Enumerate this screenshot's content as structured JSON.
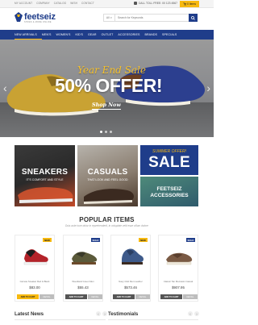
{
  "topbar": {
    "links": [
      "MY ACCOUNT",
      "COMPANY",
      "CATALOG",
      "WISH",
      "CONTACT"
    ],
    "phone": "CALL TOLL FREE: 00 123 4567",
    "cart_label": "0 Items"
  },
  "header": {
    "logo_text": "feetseiz",
    "logo_tagline": "SHOES & MORE ONLINE",
    "search_category": "All",
    "search_placeholder": "Search for Keywords"
  },
  "nav": {
    "items": [
      "NEW ARRIVALS",
      "MEN'S",
      "WOMEN'S",
      "KID'S",
      "GEAR",
      "OUTLET",
      "ACCESSORIES",
      "BRANDS",
      "SPECIALS"
    ]
  },
  "hero": {
    "subtitle": "Year End Sale",
    "title": "50% OFFER!",
    "cta": "Shop Now"
  },
  "banners": {
    "sneakers": {
      "title": "SNEAKERS",
      "subtitle": "IT'S COMFORT AND STYLE"
    },
    "casuals": {
      "title": "CASUALS",
      "subtitle": "THAT LOOK AND FEEL GOOD"
    },
    "sale": {
      "subtitle": "SUMMER OFFER!",
      "title": "SALE"
    },
    "accessories": {
      "line1": "FEETSEIZ",
      "line2": "ACCESSORIES"
    }
  },
  "popular": {
    "title": "POPULAR ITEMS",
    "subtitle": "Duis aute irure dolor in reprehenderit, in voluptate velit esse cillum dolore",
    "products": [
      {
        "badge": "NEW",
        "name": "Canvas Sneaker Red & Black",
        "price": "$83.00",
        "add_label": "ADD TO CART",
        "detail_label": "DETAIL"
      },
      {
        "badge": "SOLD",
        "name": "Woodland Green Men",
        "price": "$55.43",
        "add_label": "ADD TO CART",
        "detail_label": "DETAIL"
      },
      {
        "badge": "NEW",
        "name": "Navy Club Men Leather",
        "price": "$573.46",
        "add_label": "ADD TO CART",
        "detail_label": "DETAIL"
      },
      {
        "badge": "SOLD",
        "name": "Classic Tan Moccasin Casual",
        "price": "$907.95",
        "add_label": "ADD TO CART",
        "detail_label": "DETAIL"
      }
    ]
  },
  "footer": {
    "latest_news": "Latest News",
    "testimonials": "Testimonials"
  },
  "colors": {
    "brand_blue": "#1f3d8a",
    "accent_yellow": "#f7b90f"
  },
  "icons": [
    "phone-icon",
    "cart-icon",
    "search-icon",
    "chevron-left-icon",
    "chevron-right-icon"
  ]
}
